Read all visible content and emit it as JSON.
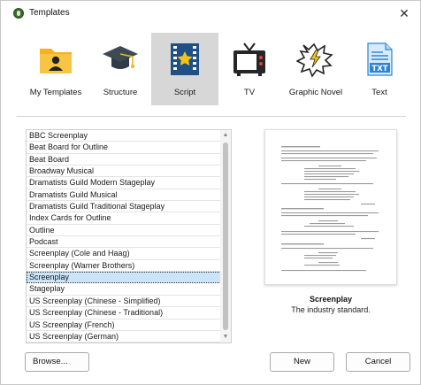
{
  "window": {
    "title": "Templates",
    "close_glyph": "✕"
  },
  "categories": [
    {
      "label": "My Templates",
      "icon": "folder-user-icon",
      "selected": false
    },
    {
      "label": "Structure",
      "icon": "graduation-cap-icon",
      "selected": false
    },
    {
      "label": "Script",
      "icon": "film-star-icon",
      "selected": true
    },
    {
      "label": "TV",
      "icon": "tv-icon",
      "selected": false
    },
    {
      "label": "Graphic Novel",
      "icon": "speech-bubble-icon",
      "selected": false
    },
    {
      "label": "Text",
      "icon": "txt-file-icon",
      "selected": false
    }
  ],
  "templates": [
    "BBC Screenplay",
    "Beat Board for Outline",
    "Beat Board",
    "Broadway Musical",
    "Dramatists Guild Modern Stageplay",
    "Dramatists Guild Musical",
    "Dramatists Guild Traditional Stageplay",
    "Index Cards for Outline",
    "Outline",
    "Podcast",
    "Screenplay (Cole and Haag)",
    "Screenplay (Warner Brothers)",
    "Screenplay",
    "Stageplay",
    "US Screenplay (Chinese - Simplified)",
    "US Screenplay (Chinese - Traditional)",
    "US Screenplay (French)",
    "US Screenplay (German)"
  ],
  "selected_template": "Screenplay",
  "scrollbar": {
    "up_glyph": "▲",
    "down_glyph": "▼"
  },
  "preview": {
    "title": "Screenplay",
    "description": "The industry standard."
  },
  "buttons": {
    "browse": "Browse...",
    "new": "New",
    "cancel": "Cancel"
  },
  "colors": {
    "selected_category_bg": "#d7d7d7",
    "selected_row_bg": "#cce4f7",
    "folder_yellow": "#f5b21c",
    "cap_dark": "#3d4a56",
    "film_blue": "#1e4f86",
    "star_yellow": "#f5c21a",
    "text_file_blue": "#2b84d6"
  }
}
